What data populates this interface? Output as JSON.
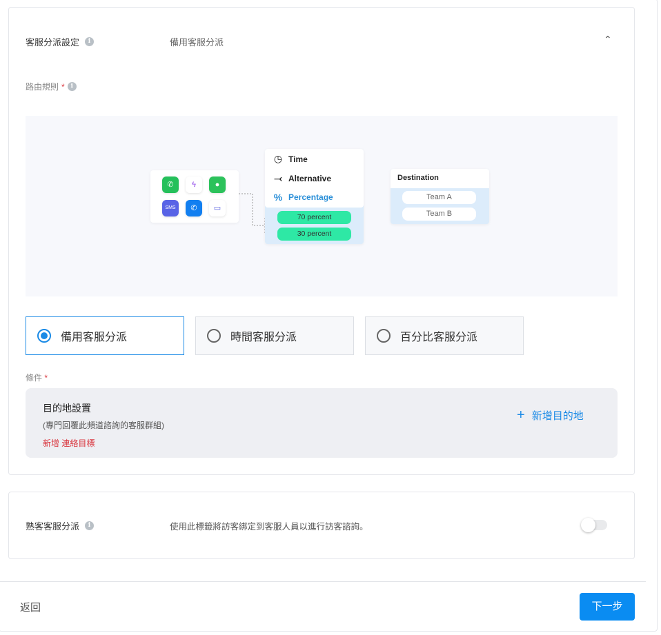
{
  "dispatch_settings": {
    "label": "客服分派設定",
    "value": "備用客服分派"
  },
  "routing_rule": {
    "label": "路由規則",
    "required": "*"
  },
  "illustration": {
    "channels": [
      "whatsapp",
      "messenger",
      "wechat",
      "sms",
      "phone",
      "webchat"
    ],
    "menu": [
      "Time",
      "Alternative",
      "Percentage"
    ],
    "percent_pills": [
      "70 percent",
      "30 percent"
    ],
    "destination_title": "Destination",
    "teams": [
      "Team A",
      "Team B"
    ]
  },
  "options": [
    {
      "label": "備用客服分派",
      "selected": true
    },
    {
      "label": "時間客服分派",
      "selected": false
    },
    {
      "label": "百分比客服分派",
      "selected": false
    }
  ],
  "condition": {
    "label": "條件",
    "required": "*",
    "title": "目的地設置",
    "subtitle": "(專門回覆此頻道諮詢的客服群組)",
    "add_contact": "新增 連絡目標",
    "add_destination": "新增目的地"
  },
  "returning": {
    "label": "熟客客服分派",
    "description": "使用此標籤將訪客綁定到客服人員以進行訪客諮詢。",
    "enabled": false
  },
  "footer": {
    "back": "返回",
    "next": "下一步"
  },
  "colors": {
    "primary": "#1a8ae6",
    "button": "#0a8cf2",
    "required": "#d9363e",
    "pill": "#2ee8a5"
  }
}
